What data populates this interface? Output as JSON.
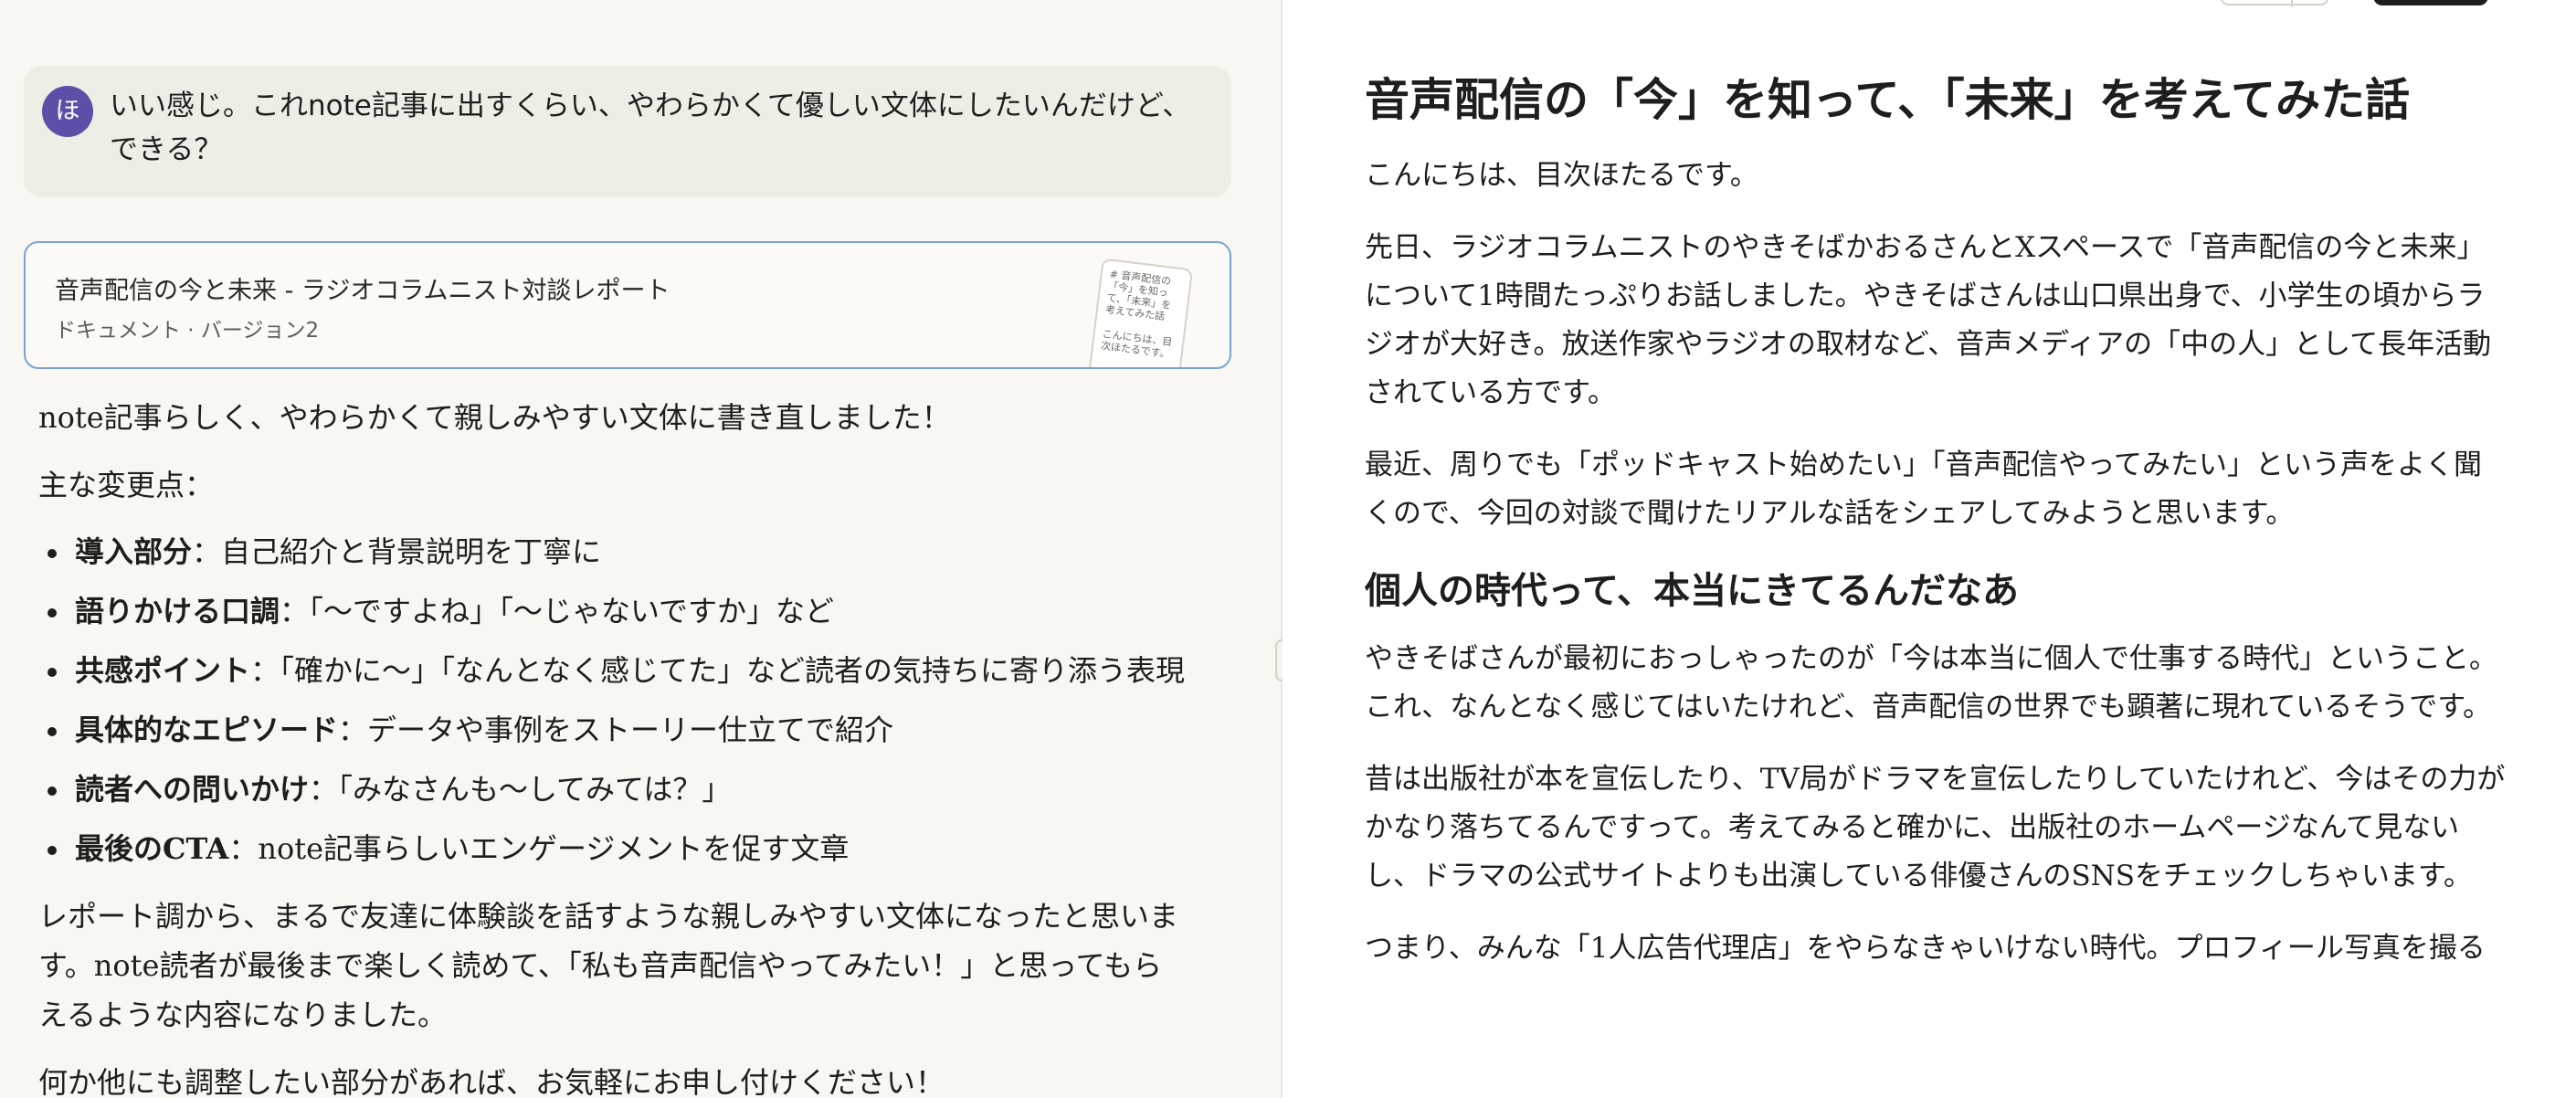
{
  "chat": {
    "user_message": {
      "avatar_initial": "ほ",
      "text": "いい感じ。これnote記事に出すくらい、やわらかくて優しい文体にしたいんだけど、できる？"
    },
    "artifact_card": {
      "title": "音声配信の今と未来 - ラジオコラムニスト対談レポート",
      "subtitle": "ドキュメント · バージョン2",
      "thumb_line1": "# 音声配信の「今」を知って、「未来」を考えてみた話",
      "thumb_line2": "こんにちは、目次ほたるです。"
    },
    "assistant": {
      "intro": "note記事らしく、やわらかくて親しみやすい文体に書き直しました！",
      "changes_label": "主な変更点：",
      "changes": [
        {
          "label": "導入部分",
          "text": "：自己紹介と背景説明を丁寧に"
        },
        {
          "label": "語りかける口調",
          "text": "：「〜ですよね」「〜じゃないですか」など"
        },
        {
          "label": "共感ポイント",
          "text": "：「確かに〜」「なんとなく感じてた」など読者の気持ちに寄り添う表現"
        },
        {
          "label": "具体的なエピソード",
          "text": "：データや事例をストーリー仕立てで紹介"
        },
        {
          "label": "読者への問いかけ",
          "text": "：「みなさんも〜してみては？」"
        },
        {
          "label": "最後のCTA",
          "text": "：note記事らしいエンゲージメントを促す文章"
        }
      ],
      "summary": "レポート調から、まるで友達に体験談を話すような親しみやすい文体になったと思います。note読者が最後まで楽しく読めて、「私も音声配信やってみたい！」と思ってもらえるような内容になりました。",
      "closing": "何か他にも調整したい部分があれば、お気軽にお申し付けください！"
    }
  },
  "document": {
    "title": "音声配信の「今」を知って、「未来」を考えてみた話",
    "greeting": "こんにちは、目次ほたるです。",
    "para1": "先日、ラジオコラムニストのやきそばかおるさんとXスペースで「音声配信の今と未来」について1時間たっぷりお話しました。やきそばさんは山口県出身で、小学生の頃からラジオが大好き。放送作家やラジオの取材など、音声メディアの「中の人」として長年活動されている方です。",
    "para2": "最近、周りでも「ポッドキャスト始めたい」「音声配信やってみたい」という声をよく聞くので、今回の対談で聞けたリアルな話をシェアしてみようと思います。",
    "section1_heading": "個人の時代って、本当にきてるんだなあ",
    "para3": "やきそばさんが最初におっしゃったのが「今は本当に個人で仕事する時代」ということ。これ、なんとなく感じてはいたけれど、音声配信の世界でも顕著に現れているそうです。",
    "para4": "昔は出版社が本を宣伝したり、TV局がドラマを宣伝したりしていたけれど、今はその力がかなり落ちてるんですって。考えてみると確かに、出版社のホームページなんて見ないし、ドラマの公式サイトよりも出演している俳優さんのSNSをチェックしちゃいます。",
    "para5": "つまり、みんな「1人広告代理店」をやらなきゃいけない時代。プロフィール写真を撮る"
  },
  "colors": {
    "left_bg": "#f8f7f2",
    "right_bg": "#ffffff",
    "user_bubble": "#efeee6",
    "avatar": "#5b4fa8",
    "card_border": "#7aa3d2"
  }
}
